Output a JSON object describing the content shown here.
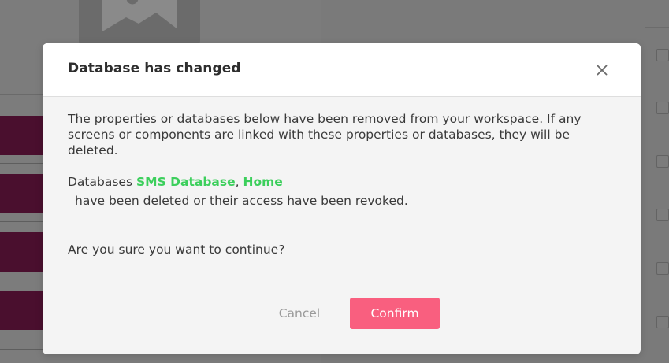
{
  "modal": {
    "title": "Database has changed",
    "message": "The properties or databases below have been removed from your workspace. If any screens or components are linked with these properties or databases, they will be deleted.",
    "databases_prefix": "Databases",
    "databases": [
      "SMS Database",
      "Home"
    ],
    "separator": ",",
    "deleted_text": "have been deleted or their access have been revoked.",
    "question": "Are you sure you want to continue?",
    "cancel_label": "Cancel",
    "confirm_label": "Confirm"
  },
  "icons": {
    "close": "close-icon",
    "background_image": "image-placeholder-icon"
  },
  "colors": {
    "overlay": "#7a7a7a",
    "modal_background": "#f4f4f4",
    "header_background": "#ffffff",
    "database_link": "#3ccf5c",
    "confirm_button": "#f95f7f",
    "background_bars": "#4a0f2e"
  }
}
